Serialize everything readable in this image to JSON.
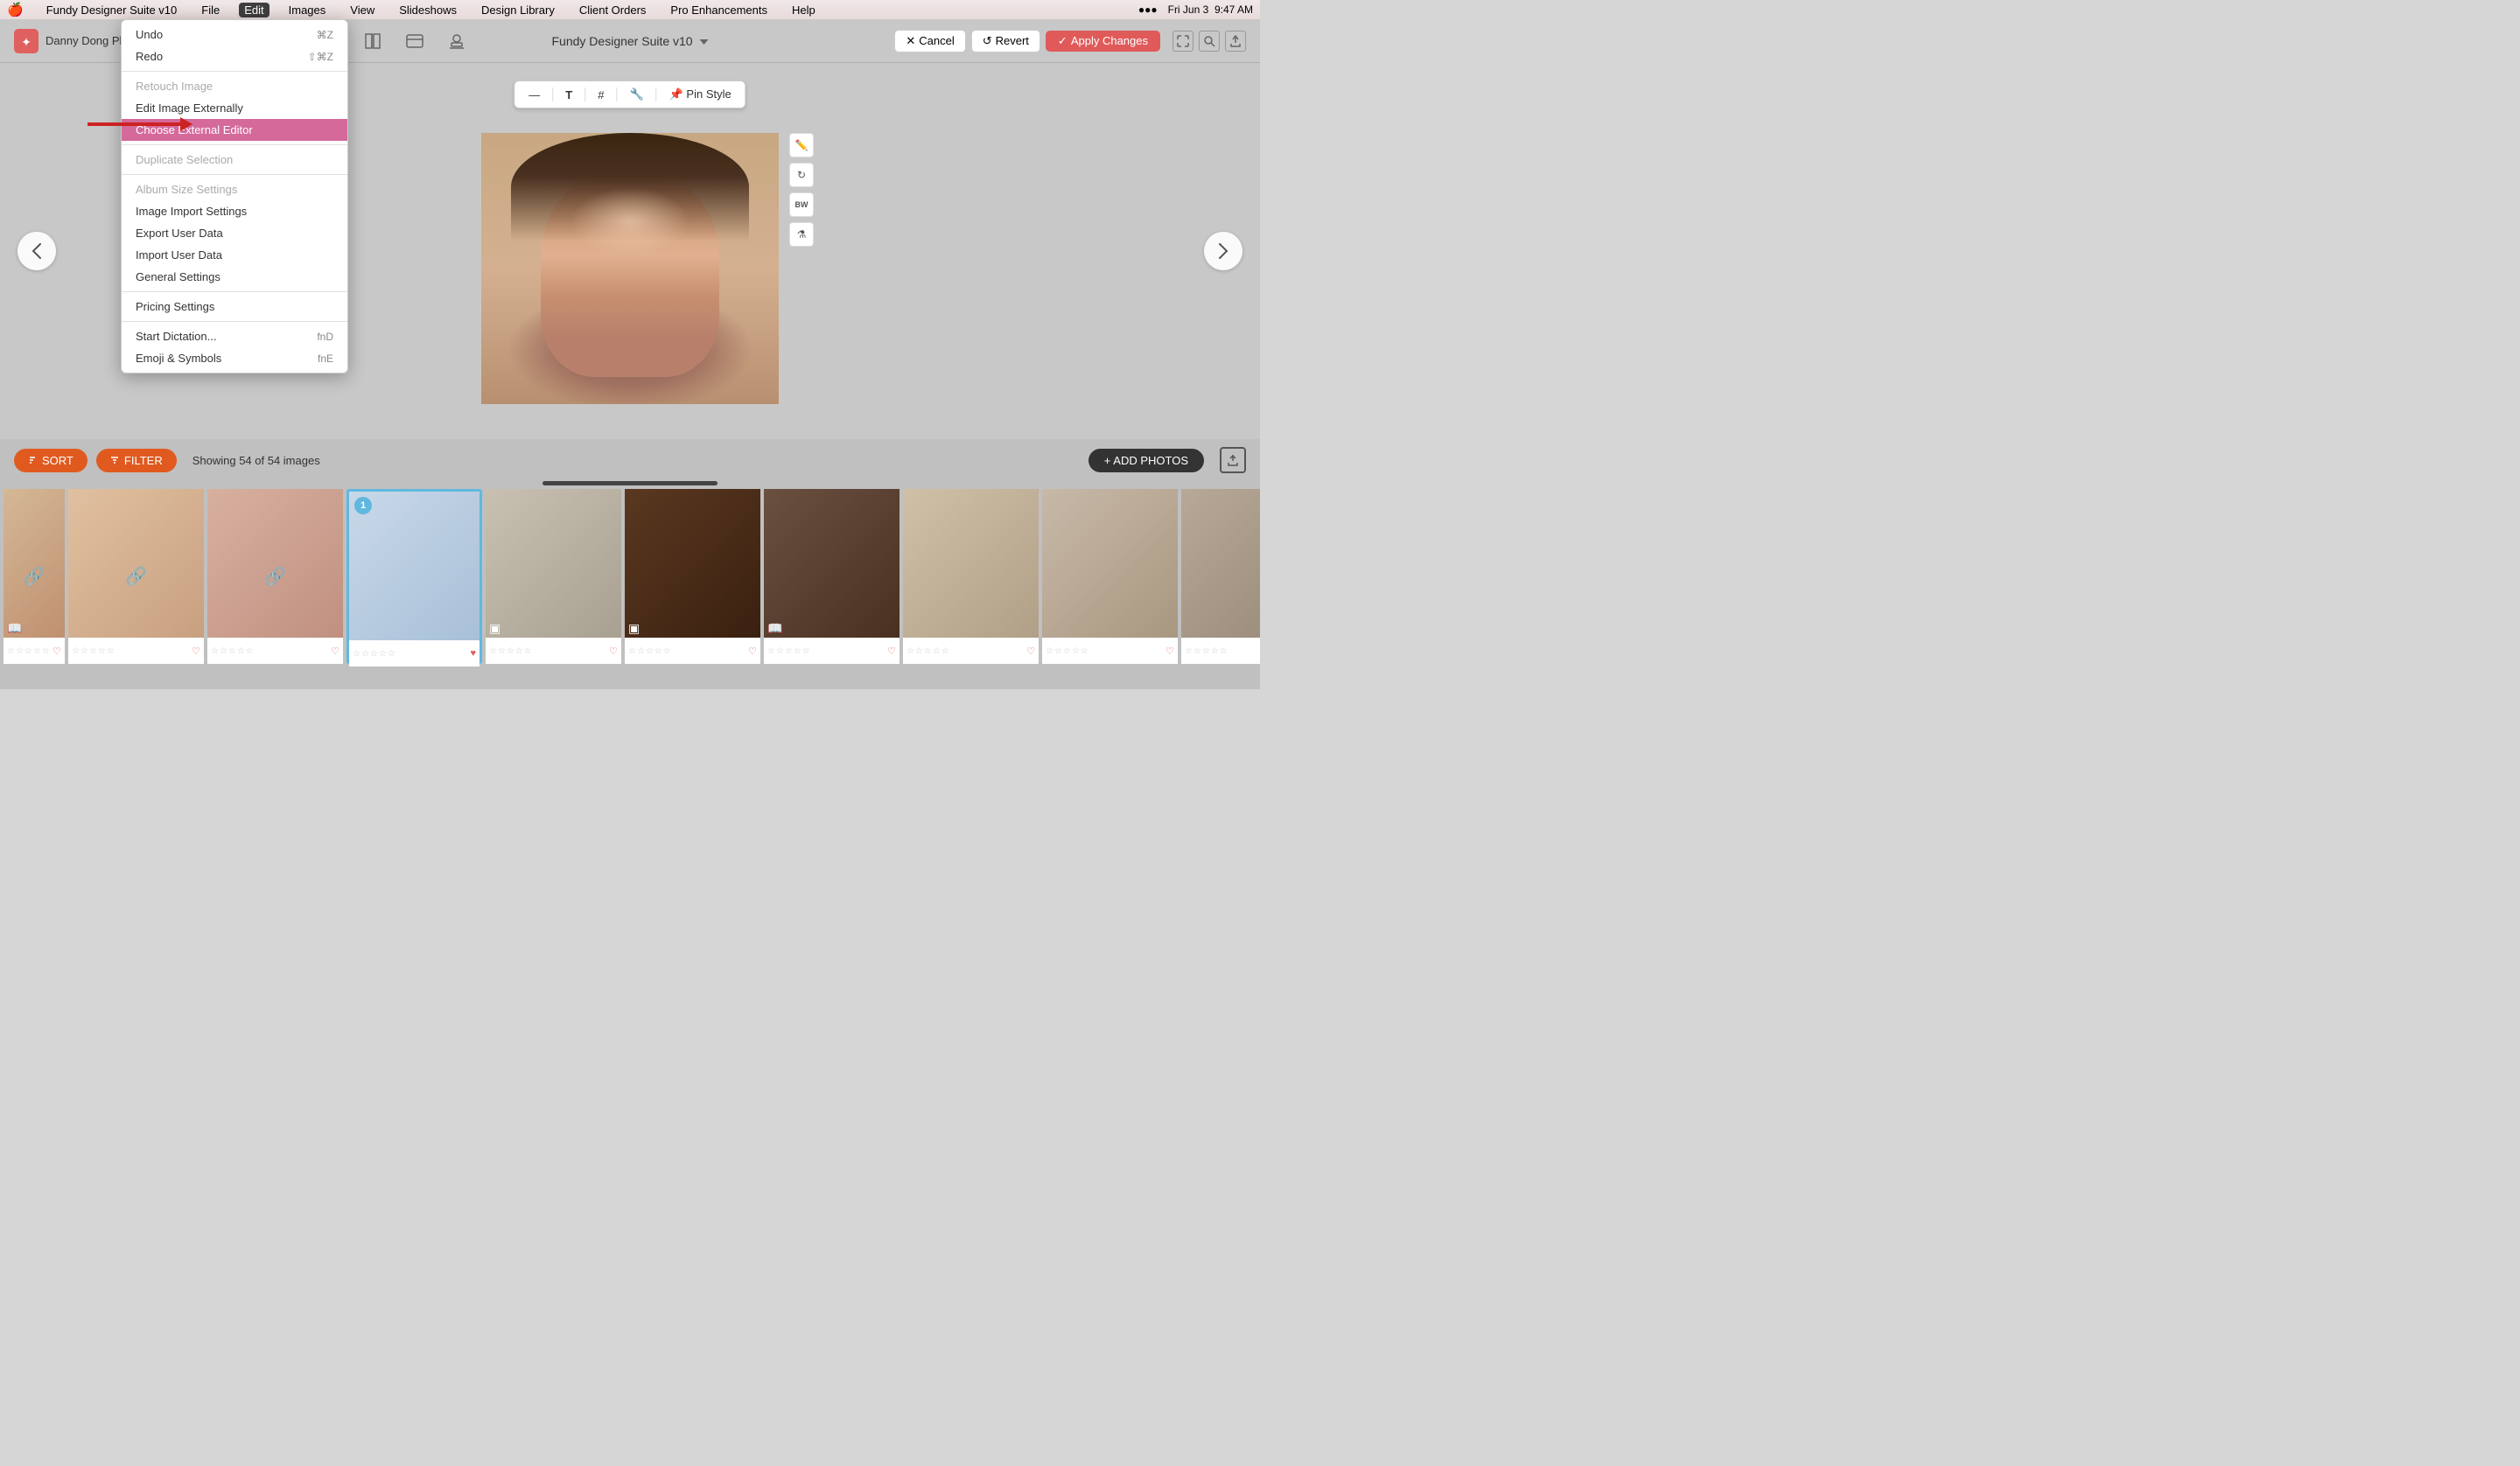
{
  "app": {
    "name": "Fundy Designer Suite v10",
    "title": "Fundy Designer Suite v10",
    "studio": "Danny Dong Photography"
  },
  "menubar": {
    "apple": "🍎",
    "items": [
      "Fundy Designer Suite v10",
      "File",
      "Edit",
      "Images",
      "View",
      "Slideshows",
      "Design Library",
      "Client Orders",
      "Pro Enhancements",
      "Help"
    ],
    "active_item": "Edit",
    "right_items": [
      "🔍",
      "Fri Jun 3  9:47 AM"
    ]
  },
  "toolbar": {
    "title": "Fundy Designer Suite v10",
    "cancel_label": "Cancel",
    "revert_label": "Revert",
    "apply_label": "Apply Changes"
  },
  "edit_menu": {
    "items": [
      {
        "label": "Undo",
        "shortcut": "⌘Z",
        "disabled": false
      },
      {
        "label": "Redo",
        "shortcut": "⇧⌘Z",
        "disabled": false
      },
      {
        "label": "separator"
      },
      {
        "label": "Retouch Image",
        "shortcut": "",
        "disabled": true
      },
      {
        "label": "Edit Image Externally",
        "shortcut": "",
        "disabled": false
      },
      {
        "label": "Choose External Editor",
        "shortcut": "",
        "disabled": false,
        "highlighted": true
      },
      {
        "label": "separator"
      },
      {
        "label": "Duplicate Selection",
        "shortcut": "",
        "disabled": true
      },
      {
        "label": "separator"
      },
      {
        "label": "Album Size Settings",
        "shortcut": "",
        "disabled": true
      },
      {
        "label": "Image Import Settings",
        "shortcut": "",
        "disabled": false
      },
      {
        "label": "Export User Data",
        "shortcut": "",
        "disabled": false
      },
      {
        "label": "Import User Data",
        "shortcut": "",
        "disabled": false
      },
      {
        "label": "General Settings",
        "shortcut": "",
        "disabled": false
      },
      {
        "label": "separator"
      },
      {
        "label": "Pricing Settings",
        "shortcut": "",
        "disabled": false
      },
      {
        "label": "separator"
      },
      {
        "label": "Start Dictation...",
        "shortcut": "fnD",
        "disabled": false
      },
      {
        "label": "Emoji & Symbols",
        "shortcut": "fnE",
        "disabled": false
      }
    ]
  },
  "image_toolbar": {
    "buttons": [
      "—",
      "T",
      "#",
      "🔧",
      "📌 Pin Style"
    ]
  },
  "filmstrip": {
    "showing_text": "Showing 54 of 54 images",
    "sort_label": "SORT",
    "filter_label": "FILTER",
    "add_photos_label": "+ ADD PHOTOS"
  },
  "thumbnails": [
    {
      "id": 0,
      "has_link": true,
      "has_book": true
    },
    {
      "id": 1,
      "has_link": true,
      "has_book": false
    },
    {
      "id": 2,
      "has_link": true,
      "has_book": false
    },
    {
      "id": 3,
      "selected": true,
      "badge": "1",
      "has_heart": true
    },
    {
      "id": 4,
      "has_link": false,
      "has_box": true
    },
    {
      "id": 5,
      "has_link": false,
      "has_box": true
    },
    {
      "id": 6,
      "has_link": false,
      "has_book": false
    },
    {
      "id": 7,
      "has_link": false,
      "has_book": false
    },
    {
      "id": 8,
      "has_link": false,
      "has_book": false
    },
    {
      "id": 9,
      "has_link": false,
      "has_book": false
    }
  ]
}
